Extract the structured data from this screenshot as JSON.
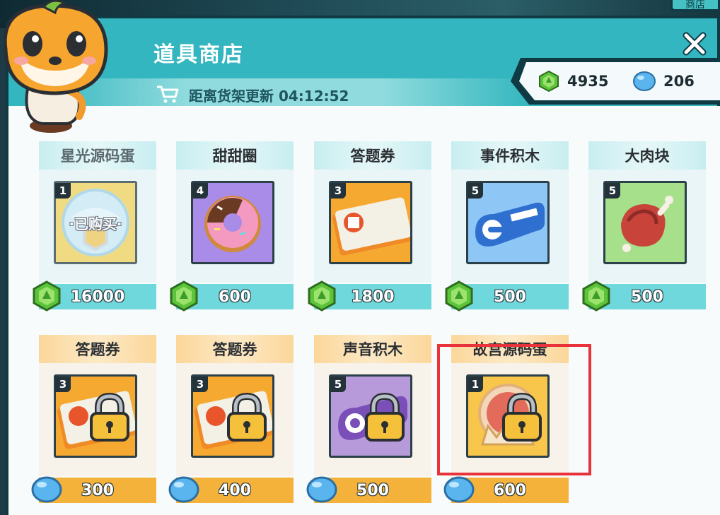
{
  "scene": {
    "tab_label": "商店"
  },
  "header": {
    "title": "道具商店",
    "refresh_text": "距离货架更新 04:12:52"
  },
  "currency": {
    "green_gem": "4935",
    "blue_gem": "206"
  },
  "colors": {
    "panel_teal": "#2db0b8",
    "outline": "#0f3a43",
    "highlight_red": "#e8333a",
    "teal_price_bar": "#6fd8dc",
    "orange_price_bar": "#f5b23a"
  },
  "items": [
    {
      "name": "星光源码蛋",
      "qty": "1",
      "price": "16000",
      "currency": "green-gem",
      "status_label": "·已购买·",
      "icon": "starlight-egg-icon"
    },
    {
      "name": "甜甜圈",
      "qty": "4",
      "price": "600",
      "currency": "green-gem",
      "icon": "donut-icon"
    },
    {
      "name": "答题券",
      "qty": "3",
      "price": "1800",
      "currency": "green-gem",
      "icon": "quiz-ticket-icon"
    },
    {
      "name": "事件积木",
      "qty": "5",
      "price": "500",
      "currency": "green-gem",
      "icon": "events-block-icon"
    },
    {
      "name": "大肉块",
      "qty": "5",
      "price": "500",
      "currency": "green-gem",
      "icon": "meat-icon"
    },
    {
      "name": "答题券",
      "qty": "3",
      "price": "300",
      "currency": "blue-gem",
      "locked": true,
      "icon": "quiz-ticket-icon"
    },
    {
      "name": "答题券",
      "qty": "3",
      "price": "400",
      "currency": "blue-gem",
      "locked": true,
      "icon": "quiz-ticket-icon"
    },
    {
      "name": "声音积木",
      "qty": "5",
      "price": "500",
      "currency": "blue-gem",
      "locked": true,
      "icon": "sound-block-icon"
    },
    {
      "name": "故宫源码蛋",
      "qty": "1",
      "price": "600",
      "currency": "blue-gem",
      "locked": true,
      "icon": "palace-egg-icon"
    }
  ]
}
